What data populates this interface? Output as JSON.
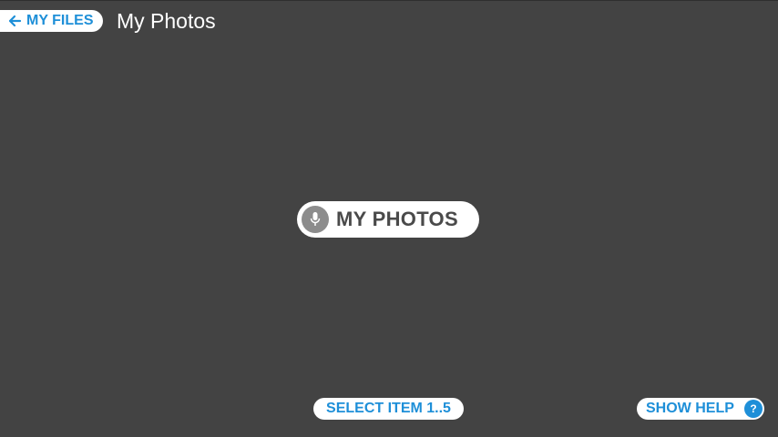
{
  "header": {
    "back_label": "MY FILES",
    "title": "My Photos"
  },
  "voice": {
    "label": "MY PHOTOS",
    "icon": "microphone-icon"
  },
  "footer": {
    "select_label": "SELECT ITEM 1..5",
    "help_label": "SHOW HELP",
    "help_glyph": "?"
  },
  "colors": {
    "background": "#434343",
    "accent": "#1e8fd8",
    "pill": "#ffffff",
    "mic_circle": "#8c8c8c"
  }
}
